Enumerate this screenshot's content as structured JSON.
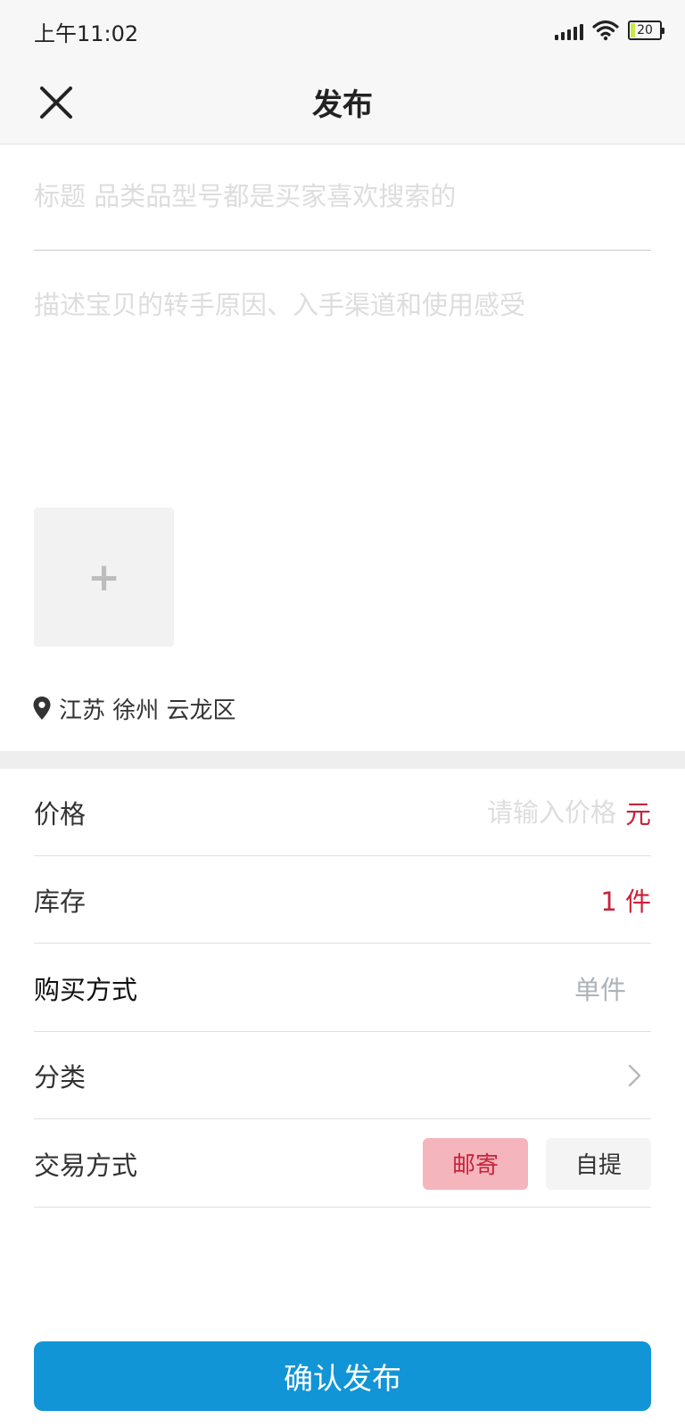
{
  "status_bar": {
    "time": "上午11:02",
    "battery": "20",
    "icons": [
      "signal-icon",
      "wifi-icon",
      "battery-icon"
    ]
  },
  "nav": {
    "title": "发布",
    "close_icon": "close-icon"
  },
  "form": {
    "title_placeholder": "标题 品类品型号都是买家喜欢搜索的",
    "description_placeholder": "描述宝贝的转手原因、入手渠道和使用感受",
    "add_image_symbol": "+",
    "location": "江苏 徐州 云龙区"
  },
  "rows": {
    "price": {
      "label": "价格",
      "placeholder": "请输入价格",
      "unit": "元"
    },
    "stock": {
      "label": "库存",
      "value": "1 件"
    },
    "purchase_method": {
      "label": "购买方式",
      "value": "单件"
    },
    "category": {
      "label": "分类"
    },
    "trade_method": {
      "label": "交易方式",
      "options": [
        "邮寄",
        "自提"
      ],
      "selected": "邮寄"
    }
  },
  "confirm_label": "确认发布",
  "colors": {
    "accent_blue": "#1195d6",
    "accent_red": "#c8233a",
    "chip_selected_bg": "#f4b5bd"
  }
}
